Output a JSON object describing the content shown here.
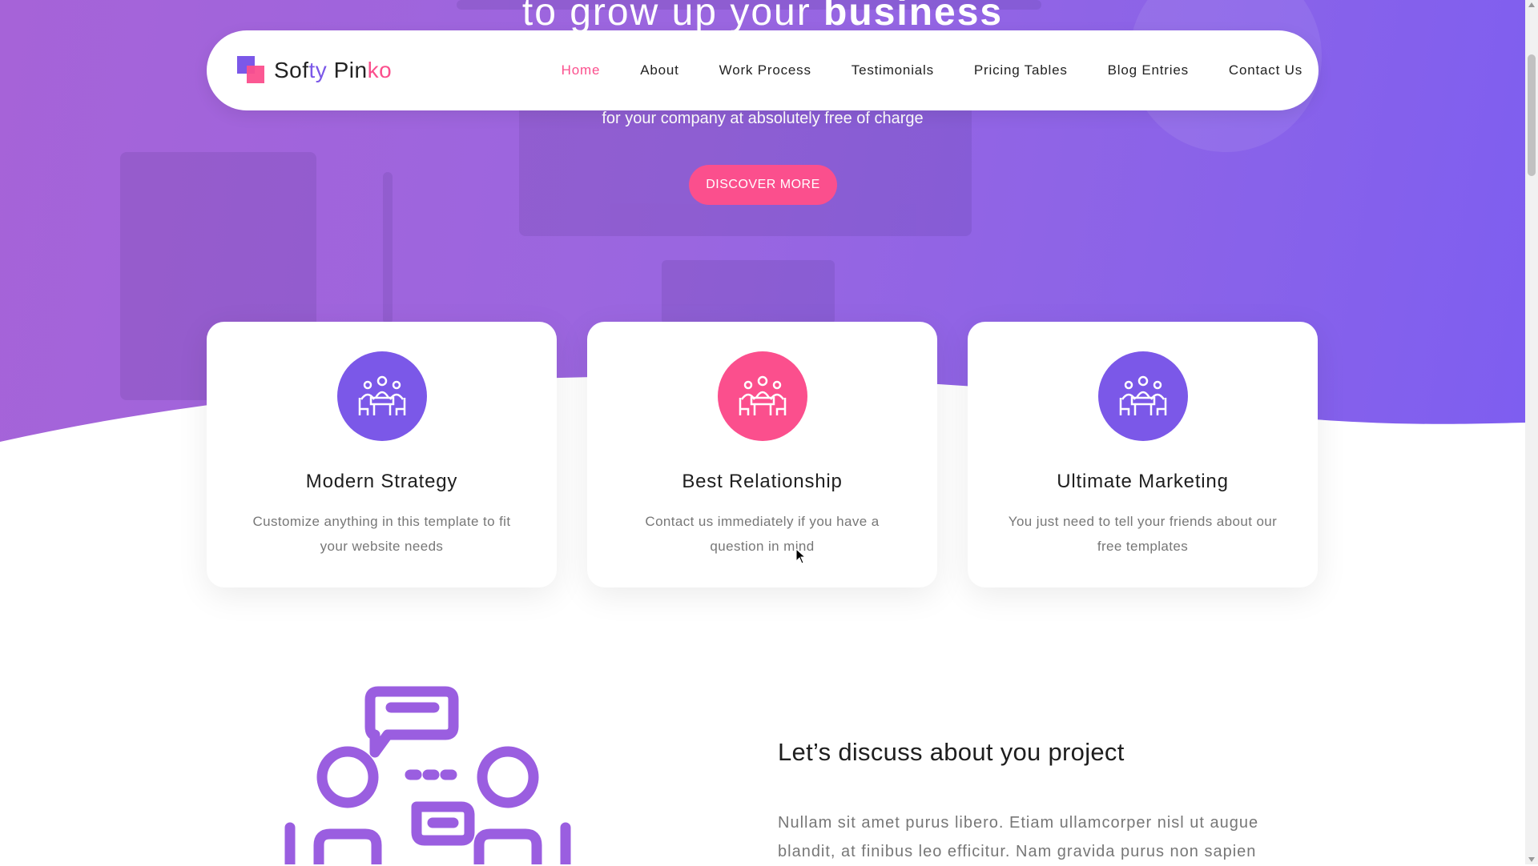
{
  "hero": {
    "title_prefix": "to grow up your",
    "title_bold": "business",
    "subtitle": "for your company at absolutely free of charge",
    "cta_label": "DISCOVER MORE"
  },
  "nav": {
    "logo_part1": "Sof",
    "logo_part2": "ty",
    "logo_part3": " Pin",
    "logo_part4": "ko",
    "items": [
      {
        "label": "Home",
        "active": true
      },
      {
        "label": "About"
      },
      {
        "label": "Work Process"
      },
      {
        "label": "Testimonials"
      },
      {
        "label": "Pricing Tables"
      },
      {
        "label": "Blog Entries"
      },
      {
        "label": "Contact Us"
      }
    ]
  },
  "features": [
    {
      "title": "Modern Strategy",
      "text": "Customize anything in this template to fit your website needs",
      "icon": "meeting-icon",
      "color": "#7b58e8"
    },
    {
      "title": "Best Relationship",
      "text": "Contact us immediately if you have a question in mind",
      "icon": "meeting-icon",
      "color": "#fb4f8d"
    },
    {
      "title": "Ultimate Marketing",
      "text": "You just need to tell your friends about our free templates",
      "icon": "meeting-icon",
      "color": "#7b58e8"
    }
  ],
  "about": {
    "title": "Let’s discuss about you project",
    "text": "Nullam sit amet purus libero. Etiam ullamcorper nisl ut augue blandit, at finibus leo efficitur. Nam gravida purus non sapien"
  },
  "colors": {
    "primary": "#7b58e8",
    "accent": "#fb4f8d"
  }
}
